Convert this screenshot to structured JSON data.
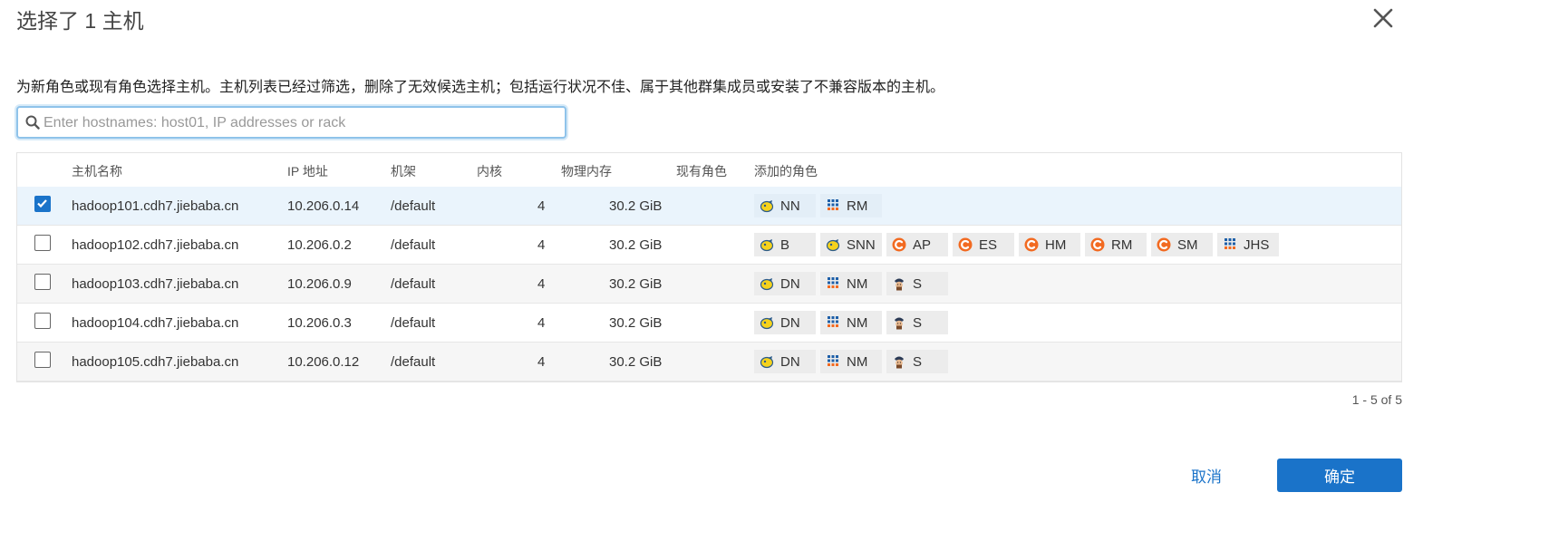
{
  "dialog": {
    "title": "选择了 1 主机",
    "description": "为新角色或现有角色选择主机。主机列表已经过筛选，删除了无效候选主机；包括运行状况不佳、属于其他群集成员或安装了不兼容版本的主机。",
    "close_icon": "close-icon"
  },
  "search": {
    "placeholder": "Enter hostnames: host01, IP addresses or rack",
    "value": "",
    "icon": "search-icon"
  },
  "table": {
    "headers": {
      "hostname": "主机名称",
      "ip": "IP 地址",
      "rack": "机架",
      "cores": "内核",
      "memory": "物理内存",
      "existing_roles": "现有角色",
      "added_roles": "添加的角色"
    },
    "rows": [
      {
        "checked": true,
        "hostname": "hadoop101.cdh7.jiebaba.cn",
        "ip": "10.206.0.14",
        "rack": "/default",
        "cores": "4",
        "memory": "30.2 GiB",
        "existing_roles": "",
        "roles": [
          {
            "icon": "hdfs-icon",
            "label": "NN"
          },
          {
            "icon": "yarn-icon",
            "label": "RM"
          }
        ]
      },
      {
        "checked": false,
        "hostname": "hadoop102.cdh7.jiebaba.cn",
        "ip": "10.206.0.2",
        "rack": "/default",
        "cores": "4",
        "memory": "30.2 GiB",
        "existing_roles": "",
        "roles": [
          {
            "icon": "hdfs-icon",
            "label": "B"
          },
          {
            "icon": "hdfs-icon",
            "label": "SNN"
          },
          {
            "icon": "cloudera-mgmt-icon",
            "label": "AP"
          },
          {
            "icon": "cloudera-mgmt-icon",
            "label": "ES"
          },
          {
            "icon": "cloudera-mgmt-icon",
            "label": "HM"
          },
          {
            "icon": "cloudera-mgmt-icon",
            "label": "RM"
          },
          {
            "icon": "cloudera-mgmt-icon",
            "label": "SM"
          },
          {
            "icon": "yarn-icon",
            "label": "JHS"
          }
        ]
      },
      {
        "checked": false,
        "hostname": "hadoop103.cdh7.jiebaba.cn",
        "ip": "10.206.0.9",
        "rack": "/default",
        "cores": "4",
        "memory": "30.2 GiB",
        "existing_roles": "",
        "roles": [
          {
            "icon": "hdfs-icon",
            "label": "DN"
          },
          {
            "icon": "yarn-icon",
            "label": "NM"
          },
          {
            "icon": "zookeeper-icon",
            "label": "S"
          }
        ]
      },
      {
        "checked": false,
        "hostname": "hadoop104.cdh7.jiebaba.cn",
        "ip": "10.206.0.3",
        "rack": "/default",
        "cores": "4",
        "memory": "30.2 GiB",
        "existing_roles": "",
        "roles": [
          {
            "icon": "hdfs-icon",
            "label": "DN"
          },
          {
            "icon": "yarn-icon",
            "label": "NM"
          },
          {
            "icon": "zookeeper-icon",
            "label": "S"
          }
        ]
      },
      {
        "checked": false,
        "hostname": "hadoop105.cdh7.jiebaba.cn",
        "ip": "10.206.0.12",
        "rack": "/default",
        "cores": "4",
        "memory": "30.2 GiB",
        "existing_roles": "",
        "roles": [
          {
            "icon": "hdfs-icon",
            "label": "DN"
          },
          {
            "icon": "yarn-icon",
            "label": "NM"
          },
          {
            "icon": "zookeeper-icon",
            "label": "S"
          }
        ]
      }
    ]
  },
  "pagination": {
    "text": "1 - 5 of 5"
  },
  "footer": {
    "cancel_label": "取消",
    "ok_label": "确定"
  },
  "colors": {
    "accent": "#1a73c9",
    "selected_row": "#eaf4fc",
    "alt_row": "#f6f6f6",
    "cloudera_orange": "#f26a21"
  }
}
